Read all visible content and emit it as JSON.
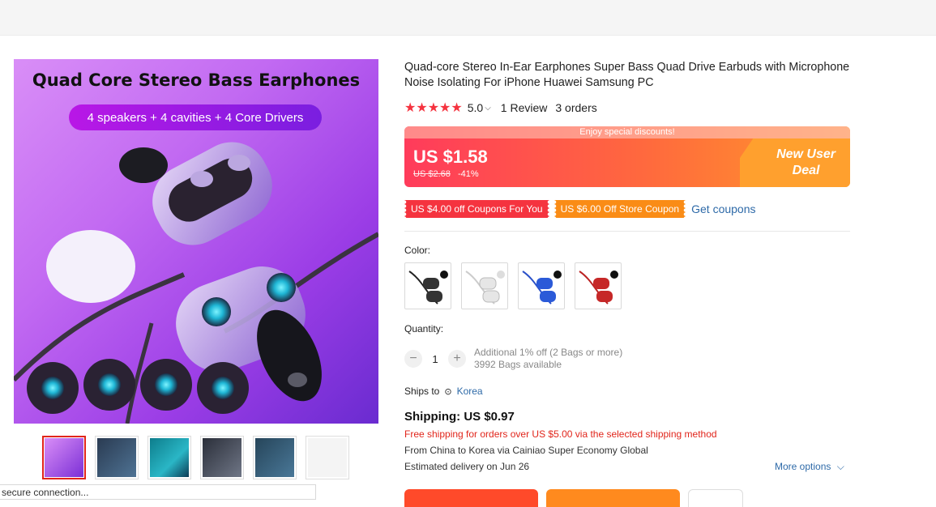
{
  "gallery": {
    "hero_title": "Quad Core Stereo Bass Earphones",
    "hero_pill": "4 speakers + 4 cavities + 4 Core Drivers",
    "thumbnail_count": 6,
    "selected_thumbnail": 1
  },
  "status_bar": {
    "text": "secure connection..."
  },
  "product": {
    "title": "Quad-core Stereo In-Ear Earphones Super Bass Quad Drive Earbuds with Microphone Noise Isolating For iPhone Huawei Samsung PC",
    "rating": "5.0",
    "stars": 5,
    "reviews": "1 Review",
    "orders": "3 orders"
  },
  "price": {
    "banner": "Enjoy special discounts!",
    "current": "US $1.58",
    "original": "US $2.68",
    "discount": "-41%",
    "deal_line1": "New User",
    "deal_line2": "Deal",
    "gradient_start": "#ff3b5b",
    "gradient_end": "#ff9a2a"
  },
  "coupons": {
    "items": [
      "US $4.00 off Coupons For You",
      "US $6.00 Off Store Coupon"
    ],
    "get_label": "Get coupons"
  },
  "color": {
    "label": "Color:",
    "options": [
      "black",
      "white",
      "blue",
      "red"
    ]
  },
  "quantity": {
    "label": "Quantity:",
    "value": "1",
    "minus": "−",
    "plus": "+",
    "offer": "Additional 1% off (2 Bags or more)",
    "available": "3992 Bags available"
  },
  "shipping": {
    "ships_to_label": "Ships to",
    "destination": "Korea",
    "cost": "Shipping: US $0.97",
    "free_note": "Free shipping for orders over US $5.00 via the selected shipping method",
    "route": "From China to Korea via Cainiao Super Economy Global",
    "estimate": "Estimated delivery on Jun 26",
    "more_options": "More options"
  },
  "colors": {
    "accent_red": "#e1251b",
    "link_blue": "#2e6aa8",
    "star": "#f5333f"
  }
}
